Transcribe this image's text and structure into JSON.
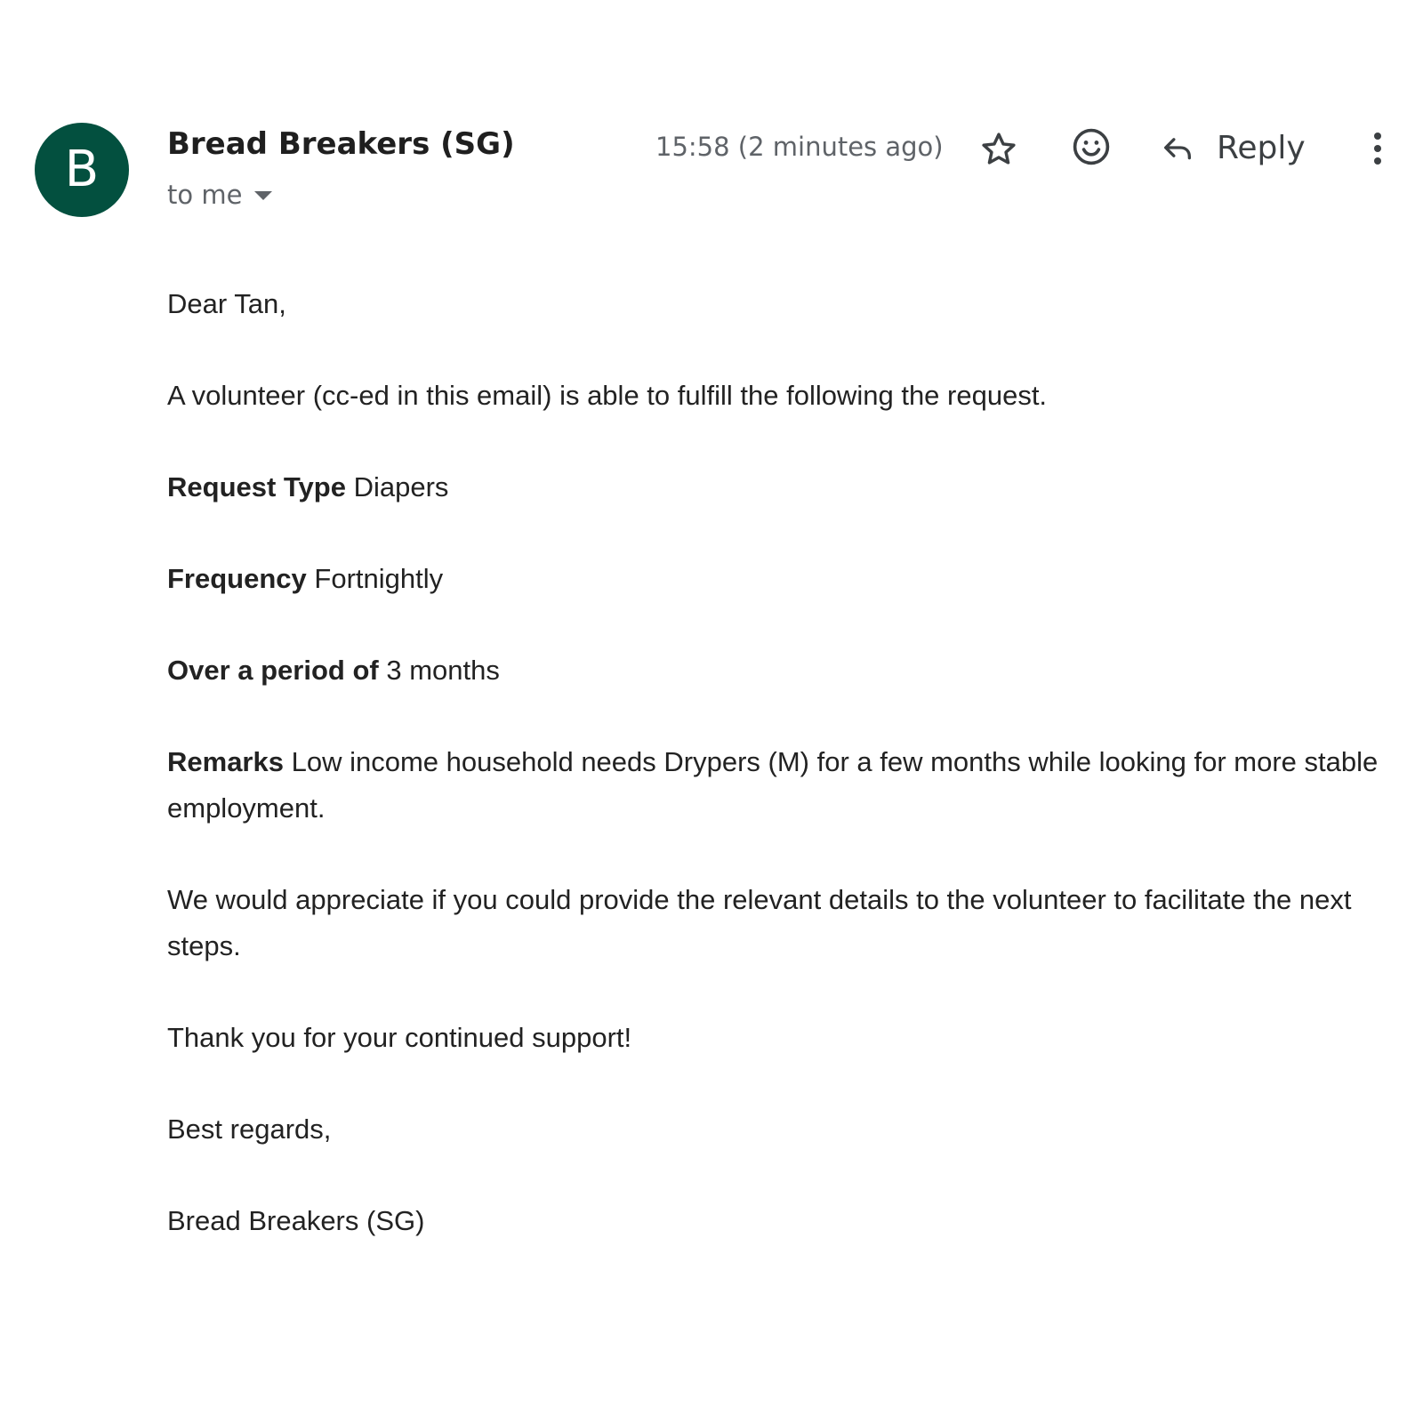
{
  "sender": {
    "avatar_letter": "B",
    "avatar_color": "#03503f",
    "name": "Bread Breakers (SG)",
    "recipient_label": "to me"
  },
  "header": {
    "timestamp": "15:58 (2 minutes ago)",
    "star_icon": "star-icon",
    "emoji_icon": "emoji-reaction-icon",
    "reply_icon": "reply-arrow-icon",
    "reply_label": "Reply",
    "more_icon": "more-vertical-icon"
  },
  "message": {
    "greeting": "Dear Tan,",
    "intro": "A volunteer (cc-ed in this email) is able to fulfill the following the request.",
    "fields": [
      {
        "label": "Request Type",
        "value": "Diapers"
      },
      {
        "label": "Frequency",
        "value": "Fortnightly"
      },
      {
        "label": "Over a period of",
        "value": "3 months"
      },
      {
        "label": "Remarks",
        "value": "Low income household needs Drypers (M) for a few months while looking for more stable employment."
      }
    ],
    "request_text": "We would appreciate if you could provide the relevant details to the volunteer to facilitate the next steps.",
    "thanks": "Thank you for your continued support!",
    "closing": "Best regards,",
    "signature": "Bread Breakers (SG)"
  }
}
